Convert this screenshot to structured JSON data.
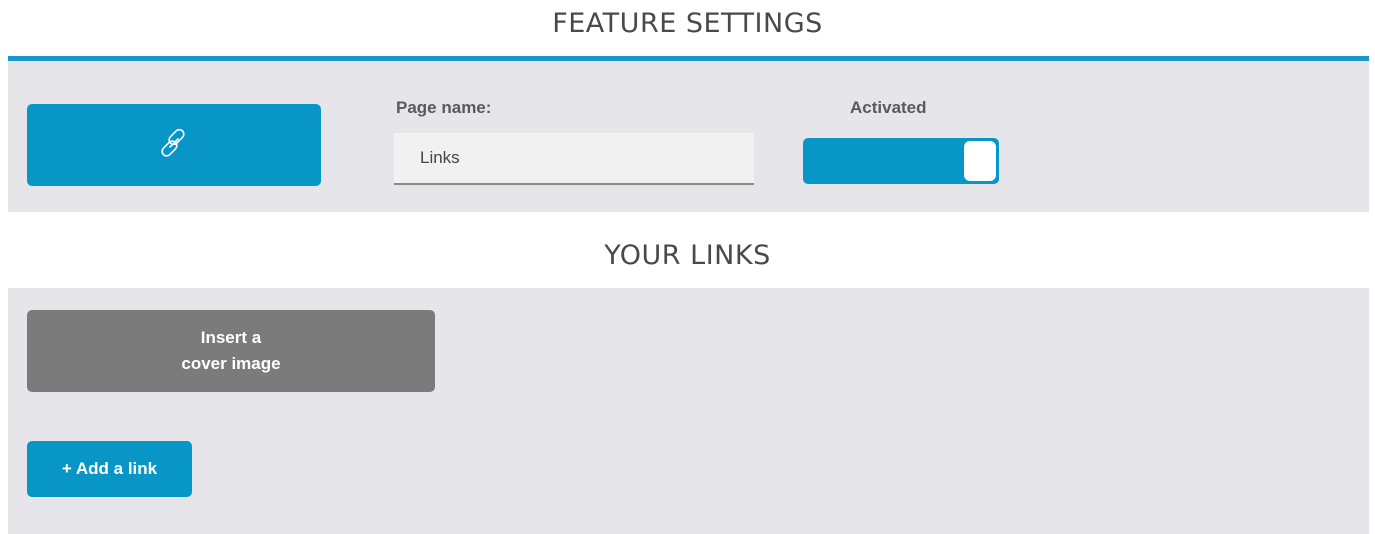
{
  "feature_settings": {
    "title": "FEATURE SETTINGS",
    "feature_icon": "link-icon",
    "page_name_label": "Page name:",
    "page_name_value": "Links",
    "activated_label": "Activated",
    "activated": true
  },
  "your_links": {
    "title": "YOUR LINKS",
    "cover_line1": "Insert a",
    "cover_line2": "cover image",
    "add_link_label": "+ Add a link"
  },
  "colors": {
    "accent": "#0796c6",
    "panel": "#e6e6ea",
    "cover_button": "#7b7b7b"
  }
}
